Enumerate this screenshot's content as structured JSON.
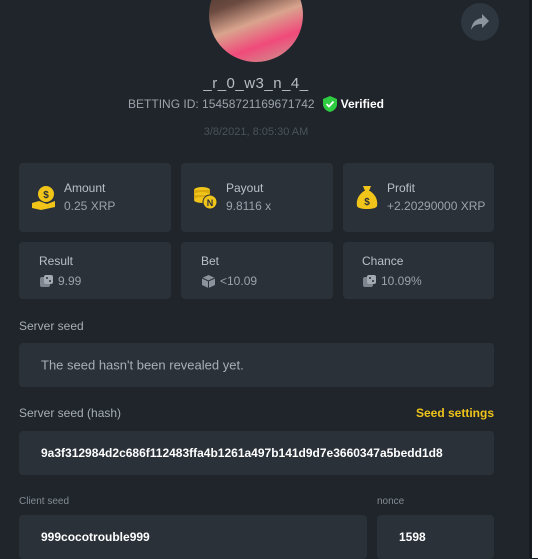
{
  "profile": {
    "username": "_r_0_w3_n_4_",
    "bet_id": "BETTING ID: 15458721169671742",
    "verified_label": "Verified",
    "timestamp": "3/8/2021, 8:05:30 AM"
  },
  "stats": {
    "amount": {
      "label": "Amount",
      "value": "0.25 XRP",
      "icon": "money-bag-hand-icon"
    },
    "payout": {
      "label": "Payout",
      "value": "9.8116 x",
      "icon": "coin-stack-icon"
    },
    "profit": {
      "label": "Profit",
      "value": "+2.20290000 XRP",
      "icon": "money-bag-icon"
    },
    "result": {
      "label": "Result",
      "value": "9.99",
      "icon": "dice-icon"
    },
    "bet": {
      "label": "Bet",
      "value": "<10.09",
      "icon": "dice-box-icon"
    },
    "chance": {
      "label": "Chance",
      "value": "10.09%",
      "icon": "dice-icon"
    }
  },
  "server_seed": {
    "label": "Server seed",
    "value": "The seed hasn't been revealed yet."
  },
  "server_seed_hash": {
    "label": "Server seed (hash)",
    "settings_link": "Seed settings",
    "value": "9a3f312984d2c686f112483ffa4b1261a497b141d9d7e3660347a5bedd1d8"
  },
  "client_seed": {
    "label": "Client seed",
    "value": "999cocotrouble999"
  },
  "nonce": {
    "label": "nonce",
    "value": "1598"
  },
  "colors": {
    "background": "#1f252b",
    "card": "#2a3139",
    "accent_yellow": "#f0c419",
    "verified_green": "#2ecc40"
  }
}
